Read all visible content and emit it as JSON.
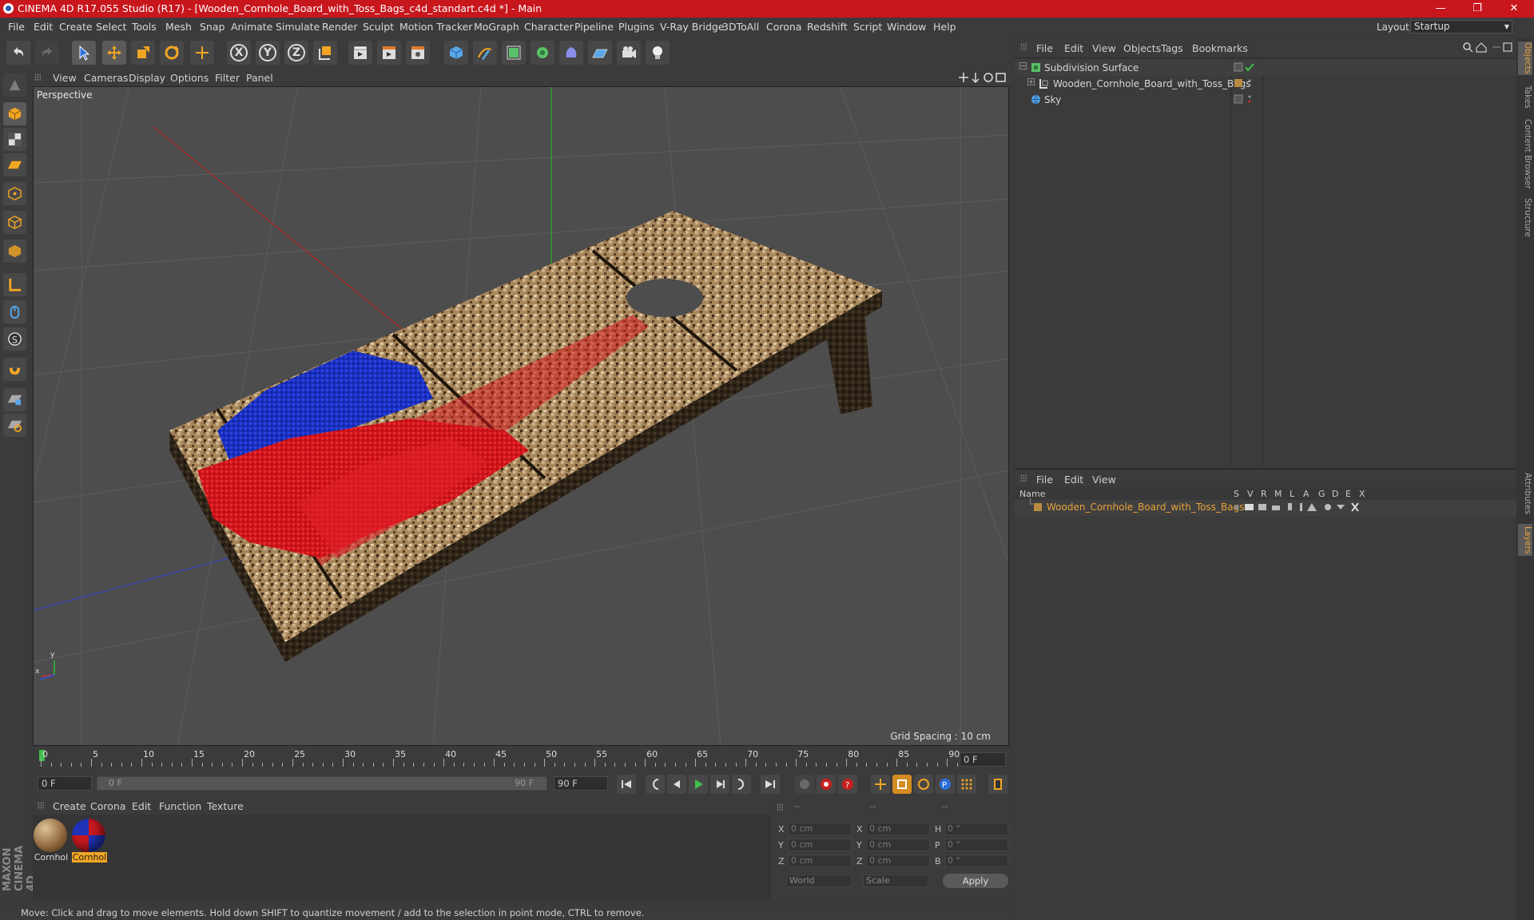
{
  "window": {
    "title": "CINEMA 4D R17.055 Studio (R17) - [Wooden_Cornhole_Board_with_Toss_Bags_c4d_standart.c4d *] - Main",
    "minimize": "—",
    "maximize": "❐",
    "close": "✕"
  },
  "menubar": {
    "items": [
      "File",
      "Edit",
      "Create",
      "Select",
      "Tools",
      "Mesh",
      "Snap",
      "Animate",
      "Simulate",
      "Render",
      "Sculpt",
      "Motion Tracker",
      "MoGraph",
      "Character",
      "Pipeline",
      "Plugins",
      "V-Ray Bridge",
      "3DToAll",
      "Corona",
      "Redshift",
      "Script",
      "Window",
      "Help"
    ],
    "layout_label": "Layout:",
    "layout_value": "Startup"
  },
  "toolbar": {
    "axis_x": "X",
    "axis_y": "Y",
    "axis_z": "Z"
  },
  "viewport": {
    "menu": [
      "View",
      "Cameras",
      "Display",
      "Options",
      "Filter",
      "Panel"
    ],
    "label": "Perspective",
    "grid_spacing": "Grid Spacing : 10 cm",
    "axis_y_label": "y",
    "axis_x_label": "x"
  },
  "timeline": {
    "ticks": [
      "0",
      "5",
      "10",
      "15",
      "20",
      "25",
      "30",
      "35",
      "40",
      "45",
      "50",
      "55",
      "60",
      "65",
      "70",
      "75",
      "80",
      "85",
      "90"
    ],
    "current_frame": "0 F",
    "start_field": "0 F",
    "range_start": "0 F",
    "range_end": "90 F",
    "end_field": "90 F"
  },
  "materials": {
    "menu": [
      "Create",
      "Corona",
      "Edit",
      "Function",
      "Texture"
    ],
    "items": [
      {
        "label": "Cornhol",
        "selected": false
      },
      {
        "label": "Cornhol",
        "selected": true
      }
    ]
  },
  "coordinates": {
    "header_pos": "--",
    "header_size": "--",
    "header_rot": "--",
    "rows": [
      {
        "a": "X",
        "av": "0 cm",
        "b": "X",
        "bv": "0 cm",
        "c": "H",
        "cv": "0 °"
      },
      {
        "a": "Y",
        "av": "0 cm",
        "b": "Y",
        "bv": "0 cm",
        "c": "P",
        "cv": "0 °"
      },
      {
        "a": "Z",
        "av": "0 cm",
        "b": "Z",
        "bv": "0 cm",
        "c": "B",
        "cv": "0 °"
      }
    ],
    "world": "World",
    "scale": "Scale",
    "apply": "Apply"
  },
  "status": "Move: Click and drag to move elements. Hold down SHIFT to quantize movement / add to the selection in point mode, CTRL to remove.",
  "objects": {
    "menu": [
      "File",
      "Edit",
      "View",
      "Objects",
      "Tags",
      "Bookmarks"
    ],
    "rows": [
      {
        "name": "Subdivision Surface"
      },
      {
        "name": "Wooden_Cornhole_Board_with_Toss_Bags"
      },
      {
        "name": "Sky"
      }
    ]
  },
  "layers": {
    "menu": [
      "File",
      "Edit",
      "View"
    ],
    "head_name": "Name",
    "head_cols": [
      "S",
      "V",
      "R",
      "M",
      "L",
      "A",
      "G",
      "D",
      "E",
      "X"
    ],
    "rows": [
      {
        "name": "Wooden_Cornhole_Board_with_Toss_Bags"
      }
    ]
  },
  "right_tabs": [
    "Objects",
    "Takes",
    "Content Browser",
    "Structure",
    "Attributes",
    "Layers"
  ],
  "brand": "MAXON CINEMA 4D",
  "colors": {
    "title_red": "#c8161d",
    "bag_blue": "#1a2fc0",
    "bag_red": "#d0141a",
    "layer_orange": "#e8a23a"
  }
}
